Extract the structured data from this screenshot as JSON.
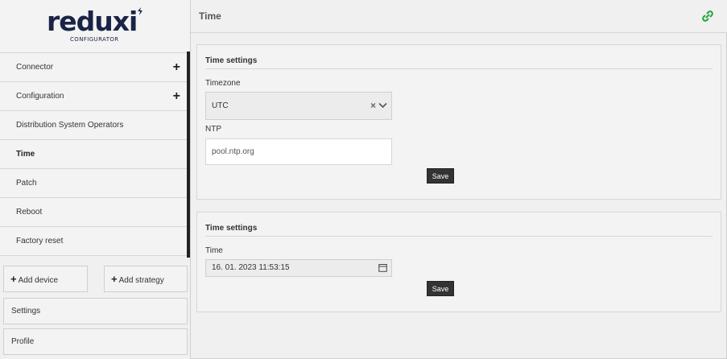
{
  "brand": {
    "name": "reduxi",
    "subtitle": "CONFIGURATOR",
    "color": "#1b2446"
  },
  "sidebar": {
    "items": [
      {
        "label": "Connector",
        "expandable": true,
        "active": false
      },
      {
        "label": "Configuration",
        "expandable": true,
        "active": false
      },
      {
        "label": "Distribution System Operators",
        "expandable": false,
        "active": false
      },
      {
        "label": "Time",
        "expandable": false,
        "active": true
      },
      {
        "label": "Patch",
        "expandable": false,
        "active": false
      },
      {
        "label": "Reboot",
        "expandable": false,
        "active": false
      },
      {
        "label": "Factory reset",
        "expandable": false,
        "active": false
      }
    ],
    "add_device_label": "Add device",
    "add_strategy_label": "Add strategy",
    "settings_label": "Settings",
    "profile_label": "Profile"
  },
  "header": {
    "title": "Time",
    "link_icon": "link-icon",
    "link_color": "#22a83a"
  },
  "timezone_panel": {
    "title": "Time settings",
    "timezone_label": "Timezone",
    "timezone_value": "UTC",
    "ntp_label": "NTP",
    "ntp_value": "pool.ntp.org",
    "save_label": "Save"
  },
  "time_panel": {
    "title": "Time settings",
    "time_label": "Time",
    "time_value": "16. 01. 2023 11:53:15",
    "save_label": "Save"
  }
}
